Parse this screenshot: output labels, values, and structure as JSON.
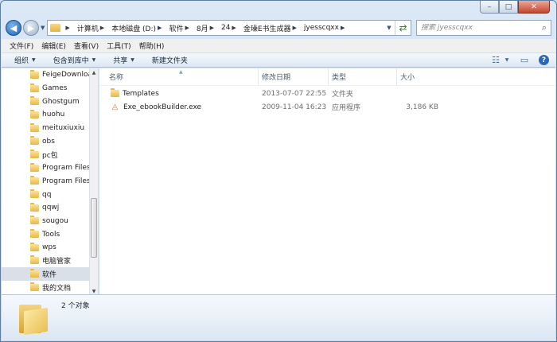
{
  "window": {
    "caption": {
      "minimize": "–",
      "maximize": "□",
      "close": "✕"
    }
  },
  "address": {
    "crumbs": [
      "计算机",
      "本地磁盘 (D:)",
      "软件",
      "8月",
      "24",
      "金璪E书生成器",
      "jyesscqxx"
    ],
    "search_placeholder": "搜索 jyesscqxx"
  },
  "menubar": {
    "items": [
      "文件(F)",
      "编辑(E)",
      "查看(V)",
      "工具(T)",
      "帮助(H)"
    ]
  },
  "commandbar": {
    "organize": "组织",
    "include_library": "包含到库中",
    "share": "共享",
    "new_folder": "新建文件夹"
  },
  "navpane": {
    "items": [
      "FeigeDownloa",
      "Games",
      "Ghostgum",
      "huohu",
      "meituxiuxiu",
      "obs",
      "pc包",
      "Program Files",
      "Program Files",
      "qq",
      "qqwj",
      "sougou",
      "Tools",
      "wps",
      "电脑管家",
      "软件",
      "我的文档"
    ],
    "selected_index": 15
  },
  "columns": {
    "name": "名称",
    "date": "修改日期",
    "type": "类型",
    "size": "大小"
  },
  "files": [
    {
      "name": "Templates",
      "date": "2013-07-07 22:55",
      "type": "文件夹",
      "size": "",
      "icon": "folder-icon"
    },
    {
      "name": "Exe_ebookBuilder.exe",
      "date": "2009-11-04 16:23",
      "type": "应用程序",
      "size": "3,186 KB",
      "icon": "exe-icon"
    }
  ],
  "status": {
    "item_count": "2 个对象"
  }
}
